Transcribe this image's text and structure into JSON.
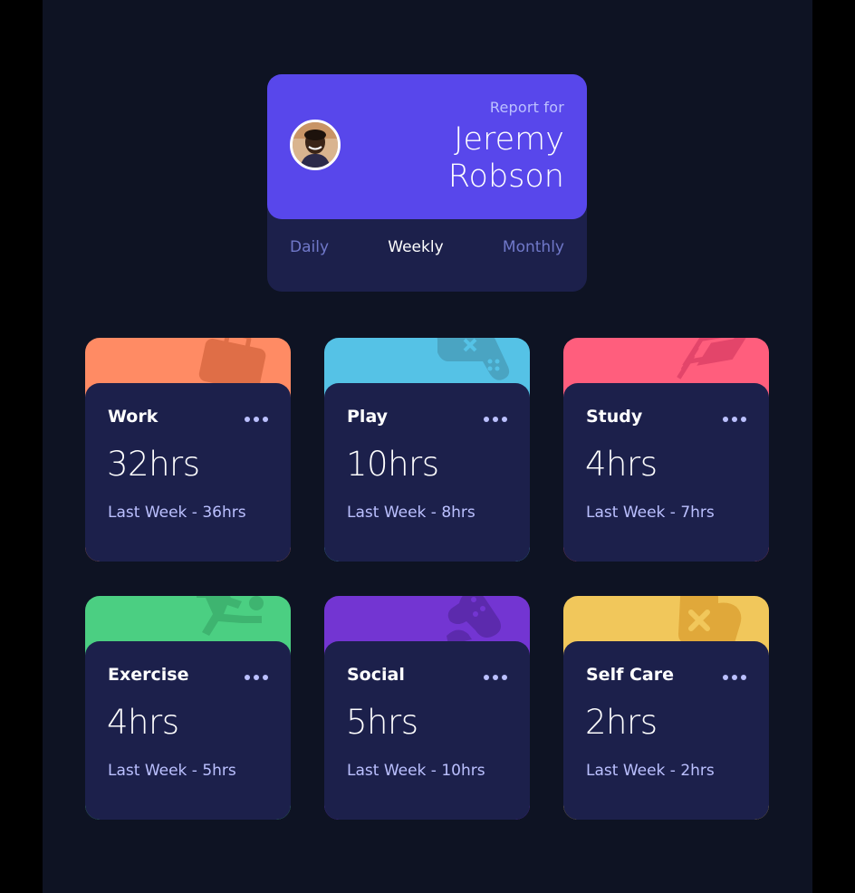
{
  "profile": {
    "report_label": "Report for",
    "name": "Jeremy Robson",
    "periods": [
      "Daily",
      "Weekly",
      "Monthly"
    ],
    "active_period": "Weekly"
  },
  "activities": [
    {
      "title": "Work",
      "current": "32hrs",
      "previous": "Last Week - 36hrs",
      "color": "#ff8b64",
      "icon": "briefcase-icon"
    },
    {
      "title": "Play",
      "current": "10hrs",
      "previous": "Last Week - 8hrs",
      "color": "#55c2e6",
      "icon": "gamepad-icon"
    },
    {
      "title": "Study",
      "current": "4hrs",
      "previous": "Last Week - 7hrs",
      "color": "#ff5e7d",
      "icon": "book-icon"
    },
    {
      "title": "Exercise",
      "current": "4hrs",
      "previous": "Last Week - 5hrs",
      "color": "#4bcf82",
      "icon": "running-icon"
    },
    {
      "title": "Social",
      "current": "5hrs",
      "previous": "Last Week - 10hrs",
      "color": "#7335d2",
      "icon": "social-icon"
    },
    {
      "title": "Self Care",
      "current": "2hrs",
      "previous": "Last Week - 2hrs",
      "color": "#f1c75b",
      "icon": "self-care-icon"
    }
  ],
  "colors": {
    "page_bg": "#0e1323",
    "card_bg": "#1c204b",
    "profile_bg": "#5847eb",
    "muted_text": "#bbc0ff"
  }
}
